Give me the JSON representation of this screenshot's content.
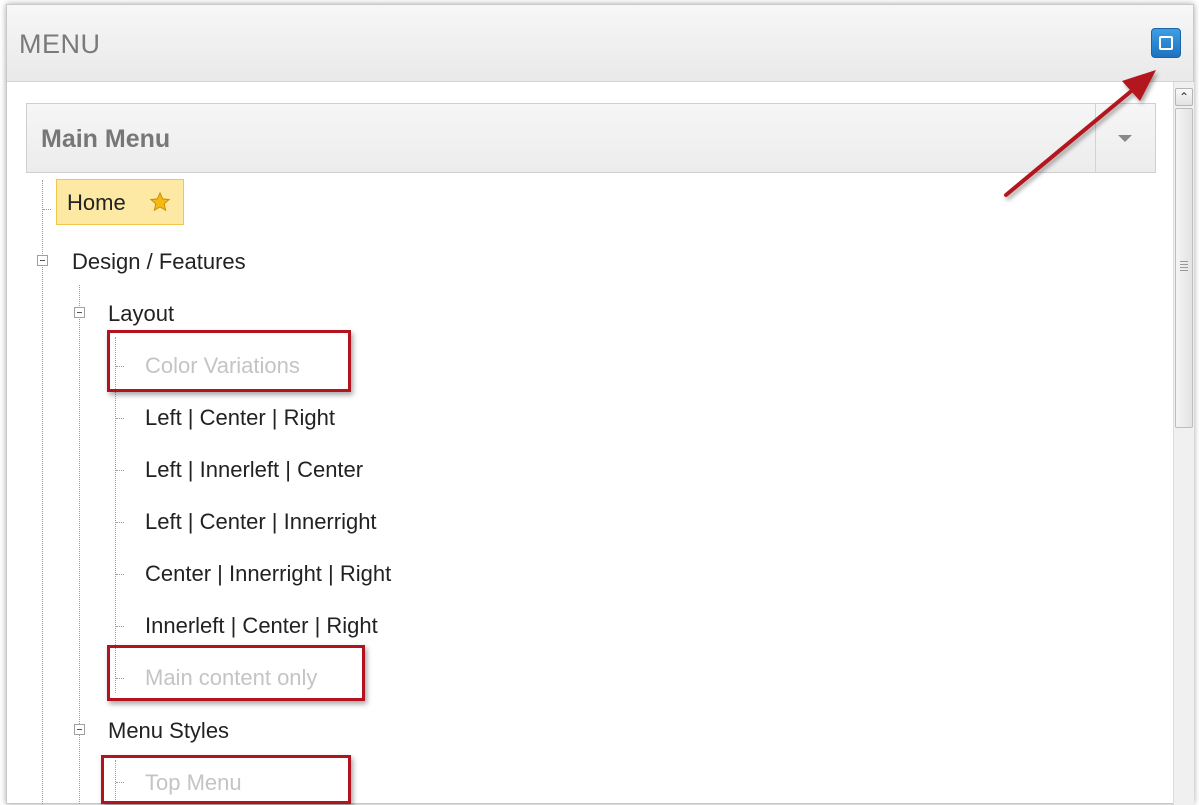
{
  "panel": {
    "title": "MENU",
    "maximize_icon": "maximize-icon"
  },
  "menu_select": {
    "selected": "Main Menu"
  },
  "tree": {
    "home": "Home",
    "design_features": "Design / Features",
    "layout": "Layout",
    "color_variations": "Color Variations",
    "left_center_right": "Left | Center | Right",
    "left_innerleft_center": "Left | Innerleft | Center",
    "left_center_innerright": "Left | Center | Innerright",
    "center_innerright_right": "Center | Innerright | Right",
    "innerleft_center_right": "Innerleft | Center | Right",
    "main_content_only": "Main content only",
    "menu_styles": "Menu Styles",
    "top_menu": "Top Menu"
  },
  "colors": {
    "accent_blue": "#2a86d3",
    "annotation_red": "#b3131f",
    "home_highlight": "#fde9a4",
    "disabled_text": "#c4c4c4"
  }
}
